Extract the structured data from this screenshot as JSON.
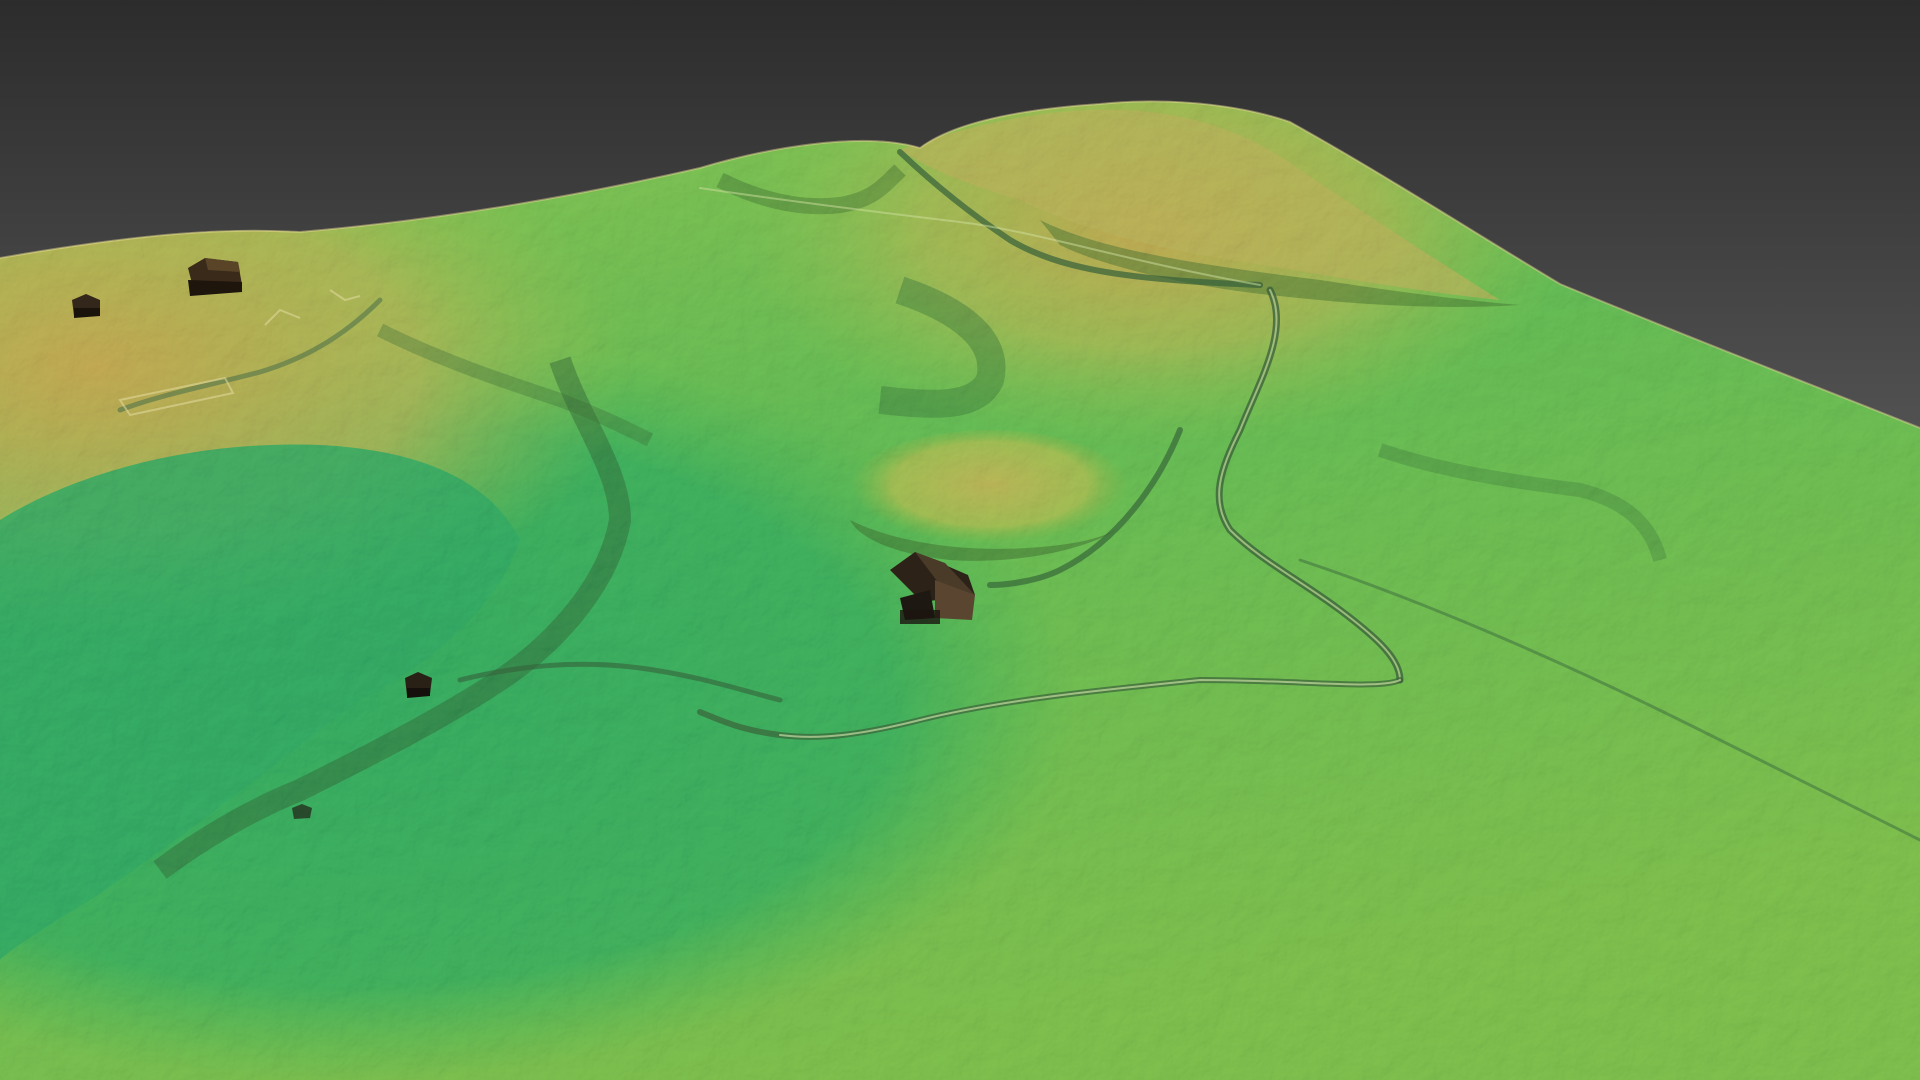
{
  "scene": {
    "background_top": "#2c2c2c",
    "background_bottom": "#8a8a8a",
    "elevation_colors": {
      "low": "#22a868",
      "mid_low": "#44b852",
      "mid": "#8cc452",
      "mid_high": "#c2c45a",
      "high": "#d2a454"
    },
    "features": {
      "terrain": "terrain-surface",
      "ridge": "ridge-hill",
      "mound": "central-mound",
      "tracks": [
        "track-north",
        "track-east",
        "track-south-loop",
        "track-west",
        "track-ridge"
      ],
      "buildings": [
        "house-central",
        "house-hilltop",
        "shed-hilltop",
        "hut-west"
      ]
    }
  }
}
